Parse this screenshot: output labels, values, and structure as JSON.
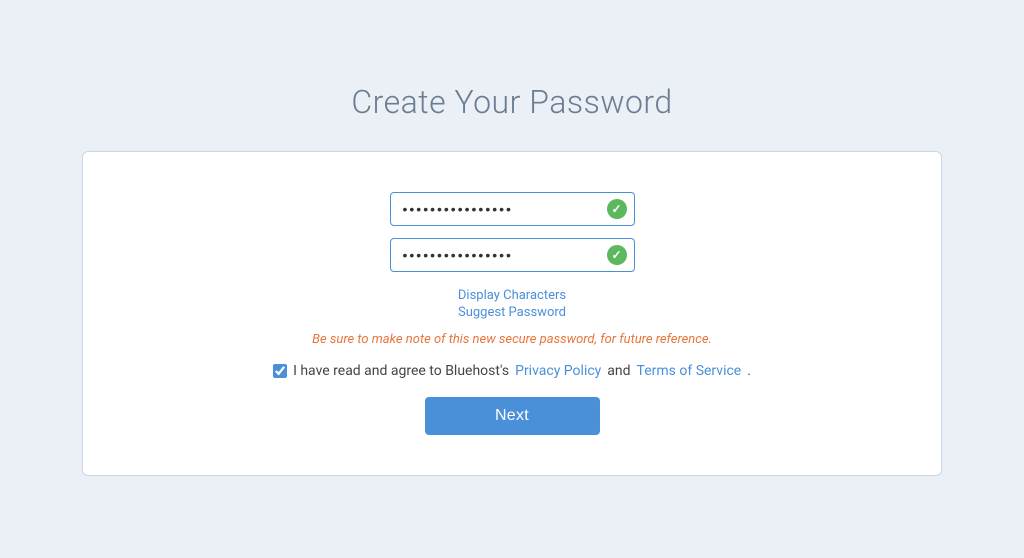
{
  "page": {
    "title": "Create Your Password",
    "background_color": "#eaf0f6"
  },
  "form": {
    "password_placeholder": "••••••••••••••••",
    "confirm_placeholder": "••••••••••••••••",
    "password_value": "••••••••••••••••",
    "confirm_value": "••••••••••••••••",
    "display_characters_label": "Display Characters",
    "suggest_password_label": "Suggest Password",
    "warning_text": "Be sure to make note of this new secure password, for future reference.",
    "agree_prefix": "I have read and agree to Bluehost's ",
    "privacy_policy_label": "Privacy Policy",
    "and_text": " and ",
    "terms_label": "Terms of Service",
    "agree_suffix": ".",
    "next_label": "Next"
  }
}
